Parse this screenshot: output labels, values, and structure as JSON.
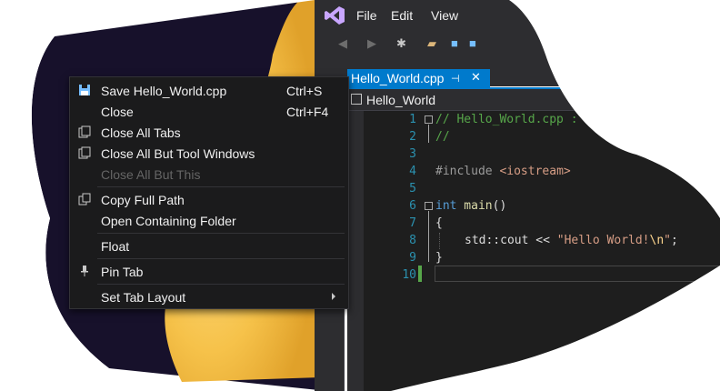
{
  "window": {
    "menu": [
      "File",
      "Edit",
      "View"
    ],
    "tab": {
      "title": "Hello_World.cpp",
      "pin_glyph": "⊣",
      "close_glyph": "✕"
    },
    "nav_project": "Hello_World"
  },
  "editor": {
    "line_numbers": [
      "1",
      "2",
      "3",
      "4",
      "5",
      "6",
      "7",
      "8",
      "9",
      "10"
    ],
    "lines": {
      "l1": "// Hello_World.cpp :",
      "l2": "//",
      "l4_pre": "#include ",
      "l4_inc": "<iostream>",
      "l6_kw": "int",
      "l6_fn": " main",
      "l6_rest": "()",
      "l7": "{",
      "l8_a": "std::cout << ",
      "l8_str": "\"Hello World!",
      "l8_esc": "\\n",
      "l8_end": "\"",
      "l8_semi": ";",
      "l9": "}"
    }
  },
  "context_menu": {
    "items": [
      {
        "label": "Save Hello_World.cpp",
        "shortcut": "Ctrl+S",
        "icon": "save-icon"
      },
      {
        "label": "Close",
        "shortcut": "Ctrl+F4",
        "icon": ""
      },
      {
        "label": "Close All Tabs",
        "shortcut": "",
        "icon": "close-all-tabs-icon"
      },
      {
        "label": "Close All But Tool Windows",
        "shortcut": "",
        "icon": "close-all-tool-icon"
      },
      {
        "label": "Close All But This",
        "shortcut": "",
        "icon": "",
        "disabled": true
      },
      {
        "label": "Copy Full Path",
        "shortcut": "",
        "icon": "copy-icon"
      },
      {
        "label": "Open Containing Folder",
        "shortcut": "",
        "icon": ""
      },
      {
        "label": "Float",
        "shortcut": "",
        "icon": ""
      },
      {
        "label": "Pin Tab",
        "shortcut": "",
        "icon": "pin-icon"
      },
      {
        "label": "Set Tab Layout",
        "shortcut": "",
        "icon": "",
        "submenu": true
      }
    ]
  },
  "colors": {
    "accent": "#007acc",
    "menu_bg": "#1b1b1c",
    "editor_bg": "#1e1e1e",
    "chrome_bg": "#2d2d30"
  }
}
